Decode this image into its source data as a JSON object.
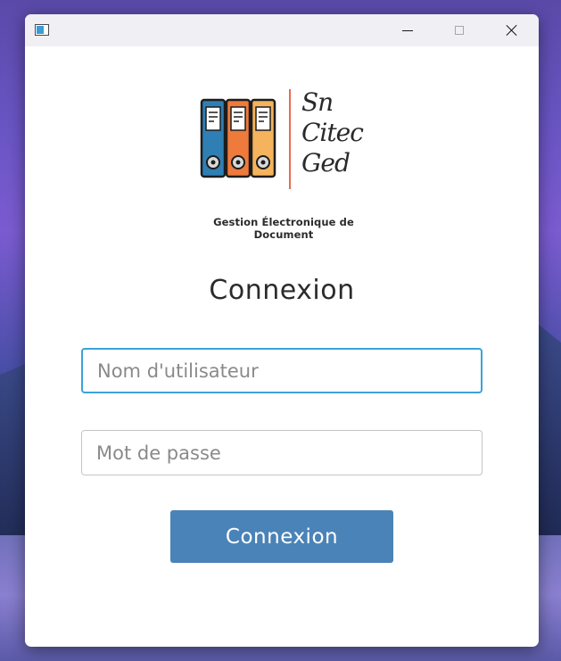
{
  "window": {
    "title_bar": {
      "app_icon": "window-app-icon",
      "minimize_icon": "minimize-icon",
      "maximize_icon": "maximize-icon",
      "close_icon": "close-icon"
    }
  },
  "logo": {
    "icon": "binders-icon",
    "script_lines": [
      "Sn",
      "Citec",
      "Ged"
    ],
    "tagline": "Gestion Électronique de Document",
    "colors": {
      "binder_blue": "#2f7fb5",
      "binder_orange": "#ee7a3c",
      "binder_yellow": "#f4b35c",
      "divider": "#e96b4a"
    }
  },
  "login": {
    "heading": "Connexion",
    "username_placeholder": "Nom d'utilisateur",
    "username_value": "",
    "password_placeholder": "Mot de passe",
    "password_value": "",
    "submit_label": "Connexion"
  },
  "colors": {
    "accent_button": "#4a83b7",
    "focus_border": "#3ba3d9",
    "title_bar": "#efeff4"
  }
}
